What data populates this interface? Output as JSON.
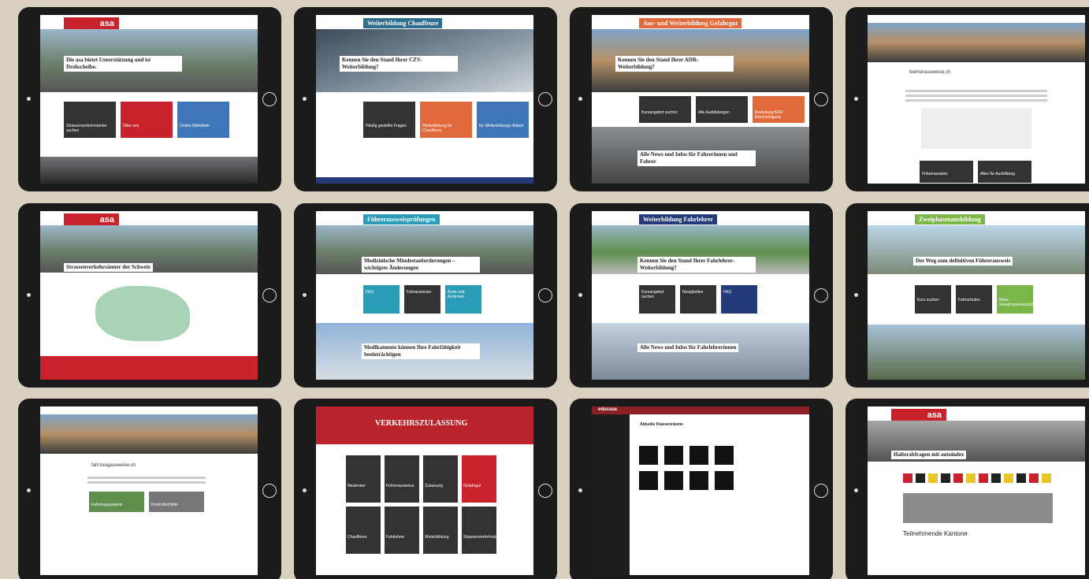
{
  "tablets": [
    {
      "logo": "asa",
      "hero": "Die asa bietet Unterstützung und ist Drehscheibe.",
      "cards": [
        "Strassenverkehrsämter suchen",
        "Über uns",
        "Online-Bibliothek"
      ]
    },
    {
      "title": "Weiterbildung Chauffeure",
      "hero": "Kennen Sie den Stand Ihrer CZV-Weiterbildung?",
      "cards": [
        "Häufig gestellte Fragen",
        "Weiterbildung für Chauffeure",
        "Ihr Weiterbildungs-Ablauf"
      ]
    },
    {
      "title": "Aus- und Weiterbildung Gefahrgut",
      "hero": "Kennen Sie den Stand Ihrer ADR-Weiterbildung?",
      "cards": [
        "Kursangebot suchen",
        "Alle Ausbildungen",
        "Bestellung ADR-Bescheinigung"
      ],
      "lower": "Alle News und Infos für Fahrerinnen und Fahrer"
    },
    {
      "title": "fuehrerausweise.ch",
      "cards": [
        "Führerausweis",
        "Alles für Ausbildung"
      ]
    },
    {
      "logo": "asa",
      "hero": "Strassenverkehrsämter der Schweiz"
    },
    {
      "title": "Führerausweisprüfungen",
      "hero": "Medizinische Mindestanforderungen – wichtigste Änderungen",
      "cards": [
        "FAQ",
        "Fahrausweise",
        "Ärzte und Ärztinnen"
      ],
      "lower": "Medikamente können Ihre Fahrfähigkeit beeinträchtigen"
    },
    {
      "title": "Weiterbildung Fahrlehrer",
      "hero": "Kennen Sie den Stand Ihrer Fahrlehrer-Weiterbildung?",
      "cards": [
        "Kursangebot suchen",
        "Neuigkeiten",
        "FAQ"
      ],
      "lower": "Alle News und Infos für Fahrlehrerinnen"
    },
    {
      "title": "Zweiphasenausbildung",
      "hero": "Der Weg zum definitiven Führerausweis",
      "cards": [
        "Kurs suchen",
        "Fahrschulen",
        "Neue Zweiphasenausbildung"
      ]
    },
    {
      "title": "fahrzeugausweise.ch",
      "cards": [
        "Fahrzeugausweis",
        "Kontrollschilder"
      ]
    },
    {
      "hero": "VERKEHRSZULASSUNG",
      "tiles": [
        "Neulenker",
        "Führerausweise",
        "Zulassung",
        "Gefahrgut",
        "Chauffeure",
        "Fahrlehrer",
        "Weiterbildung",
        "Strassenverkehrsämter"
      ]
    },
    {
      "logo": "educasa",
      "title": "Aktuelle Klassenräume"
    },
    {
      "logo": "asa",
      "hero": "Halterabfragen mit autoindex",
      "heading": "Teilnehmende Kantone"
    }
  ]
}
